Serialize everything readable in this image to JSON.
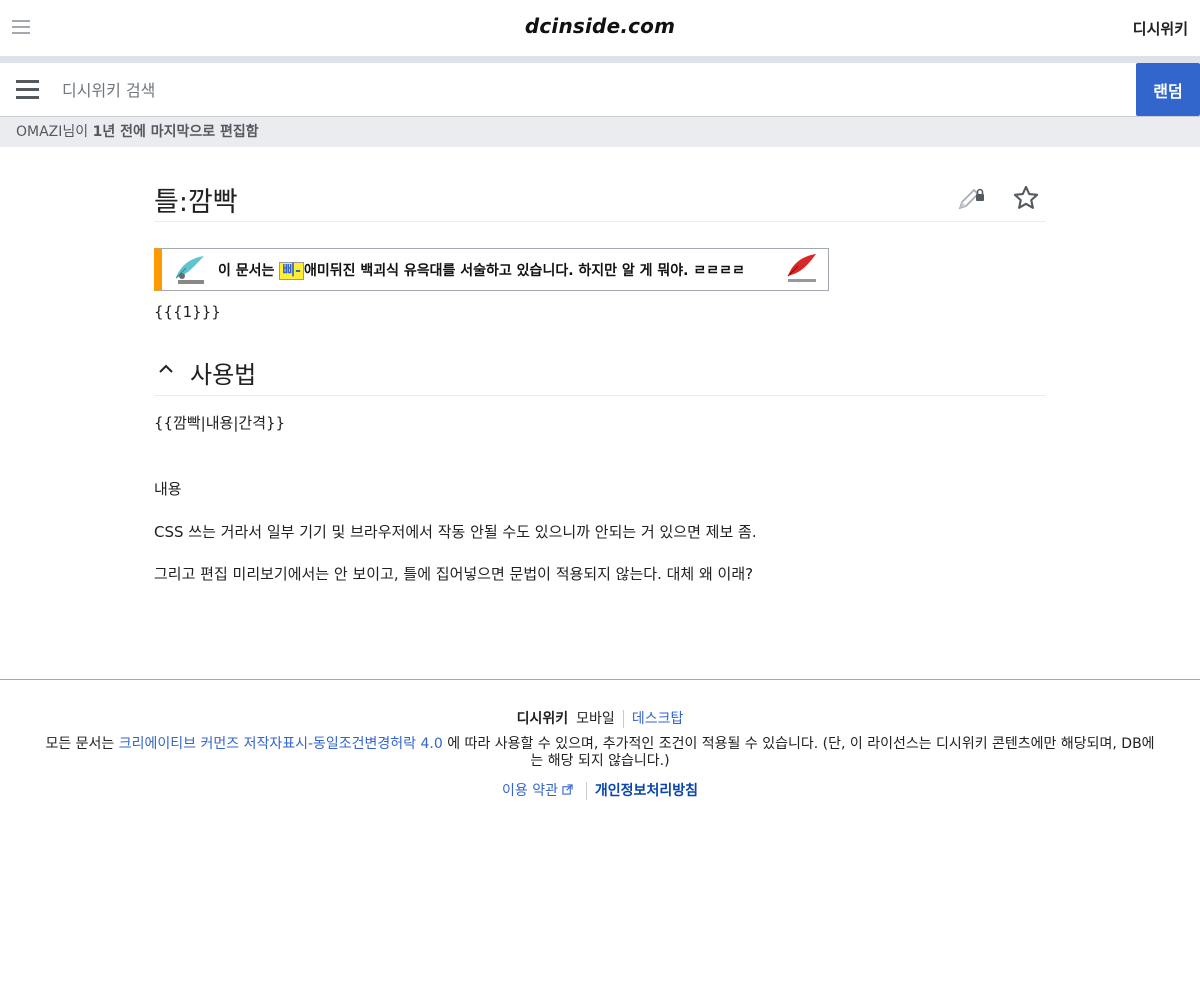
{
  "header": {
    "logo_text": "dcinside.com",
    "wiki_link": "디시위키"
  },
  "search": {
    "placeholder": "디시위키 검색",
    "random_label": "랜덤"
  },
  "last_edit": {
    "user": "OMAZI",
    "suffix": "님이 ",
    "time": "1년 전에 마지막으로 편집함"
  },
  "page": {
    "title": "틀:깜빡",
    "notice": {
      "before": "이 문서는 ",
      "highlight": "삐-",
      "after": "애미뒤진 백괴식 유윽대를 서술하고 있습니다. 하지만 알 게 뭐야. ㄹㄹㄹㄹ"
    },
    "param": "{{{1}}}",
    "section_title": "사용법",
    "usage_code": "{{깜빡|내용|간격}}",
    "content_word": "내용",
    "para1": "CSS 쓰는 거라서 일부 기기 및 브라우저에서 작동 안될 수도 있으니까 안되는 거 있으면 제보 좀.",
    "para2": "그리고 편집 미리보기에서는 안 보이고, 틀에 집어넣으면 문법이 적용되지 않는다. 대체 왜 이래?"
  },
  "footer": {
    "site": "디시위키",
    "mobile": "모바일",
    "desktop": "데스크탑",
    "license_before": "모든 문서는 ",
    "license_link": "크리에이티브 커먼즈 저작자표시-동일조건변경허락 4.0",
    "license_after": " 에 따라 사용할 수 있으며, 추가적인 조건이 적용될 수 있습니다. (단, 이 라이선스는 디시위키 콘텐츠에만 해당되며, DB에는 해당 되지 않습니다.)",
    "terms": "이용 약관",
    "privacy": "개인정보처리방침"
  },
  "icons": {
    "menu": "hamburger-icon",
    "edit": "pencil-lock-icon",
    "watch": "star-icon",
    "collapse": "chevron-up-icon",
    "external": "external-link-icon"
  },
  "colors": {
    "accent": "#3366cc",
    "notice_border": "#ff9900",
    "highlight": "#ffee33"
  }
}
